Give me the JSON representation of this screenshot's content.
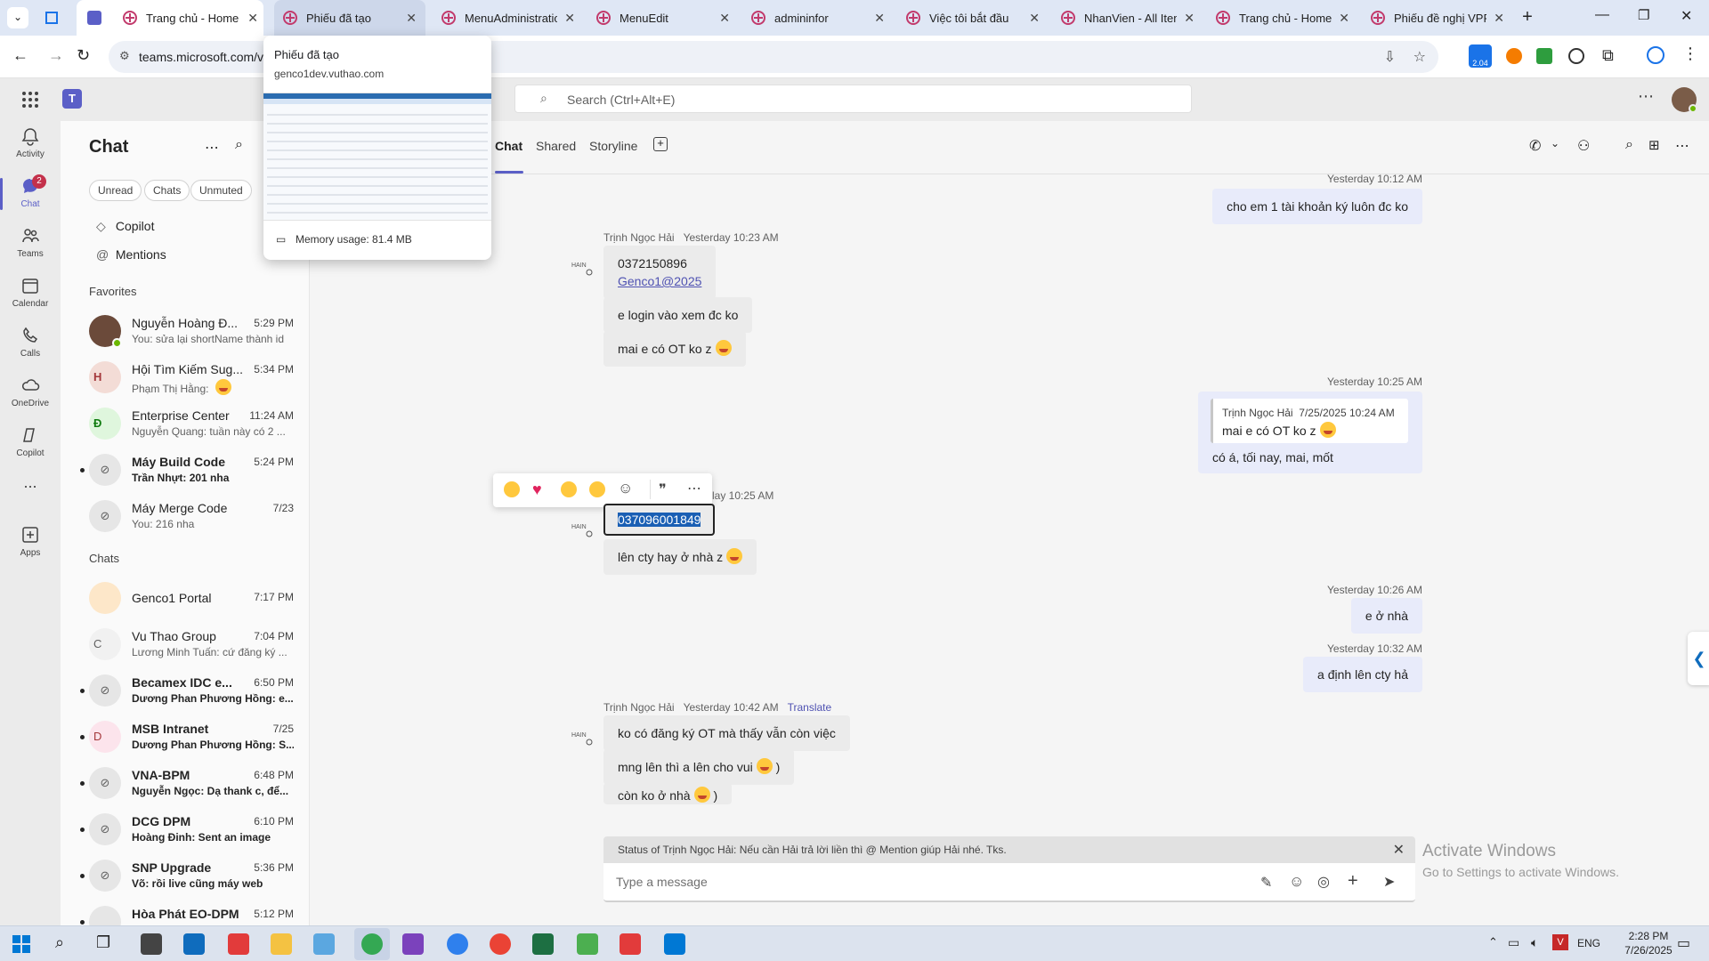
{
  "browser": {
    "tabs": [
      {
        "title": ""
      },
      {
        "title": "Trang chủ - Home"
      },
      {
        "title": "Phiếu đã tạo"
      },
      {
        "title": "MenuAdministratio"
      },
      {
        "title": "MenuEdit"
      },
      {
        "title": "admininfor"
      },
      {
        "title": "Việc tôi bắt đầu"
      },
      {
        "title": "NhanVien - All Item"
      },
      {
        "title": "Trang chủ - Home"
      },
      {
        "title": "Phiếu đề nghị VPP"
      }
    ],
    "url": "teams.microsoft.com/v",
    "ext_badge": "2.04"
  },
  "hover_card": {
    "title": "Phiếu đã tạo",
    "domain": "genco1dev.vuthao.com",
    "memory": "Memory usage: 81.4 MB"
  },
  "teams": {
    "search_placeholder": "Search (Ctrl+Alt+E)",
    "rail": [
      {
        "label": "Activity",
        "icon": "bell-icon"
      },
      {
        "label": "Chat",
        "icon": "chat-icon",
        "badge": "2"
      },
      {
        "label": "Teams",
        "icon": "teams-icon"
      },
      {
        "label": "Calendar",
        "icon": "calendar-icon"
      },
      {
        "label": "Calls",
        "icon": "phone-icon"
      },
      {
        "label": "OneDrive",
        "icon": "cloud-icon"
      },
      {
        "label": "Copilot",
        "icon": "copilot-icon"
      },
      {
        "label": "Apps",
        "icon": "apps-icon"
      }
    ],
    "more_label": "..."
  },
  "chatlist": {
    "title": "Chat",
    "filters": [
      "Unread",
      "Chats",
      "Unmuted"
    ],
    "pinned": [
      "Copilot",
      "Mentions"
    ],
    "favorites_header": "Favorites",
    "favorites": [
      {
        "name": "Nguyễn Hoàng Đ...",
        "time": "5:29 PM",
        "preview": "You:  sửa lại shortName thành id"
      },
      {
        "name": "Hội Tìm Kiếm Sug...",
        "time": "5:34 PM",
        "preview": "Phạm Thị Hằng: "
      },
      {
        "name": "Enterprise Center",
        "time": "11:24 AM",
        "preview": "Nguyễn Quang: tuần này có 2 ..."
      },
      {
        "name": "Máy Build Code",
        "time": "5:24 PM",
        "preview": "Trần Nhựt: 201 nha"
      },
      {
        "name": "Máy Merge Code",
        "time": "7/23",
        "preview": "You: 216  nha"
      }
    ],
    "chats_header": "Chats",
    "chats": [
      {
        "name": "Genco1 Portal",
        "time": "7:17 PM",
        "preview": ""
      },
      {
        "name": "Vu Thao Group",
        "time": "7:04 PM",
        "preview": "Lương Minh Tuấn: cứ đăng ký ..."
      },
      {
        "name": "Becamex IDC e...",
        "time": "6:50 PM",
        "preview": "Dương Phan Phương Hồng: e..."
      },
      {
        "name": "MSB Intranet",
        "time": "7/25",
        "preview": "Dương Phan Phương Hồng: S..."
      },
      {
        "name": "VNA-BPM",
        "time": "6:48 PM",
        "preview": "Nguyễn Ngọc: Dạ thank c, để..."
      },
      {
        "name": "DCG DPM",
        "time": "6:10 PM",
        "preview": "Hoàng Đinh: Sent an image"
      },
      {
        "name": "SNP Upgrade",
        "time": "5:36 PM",
        "preview": "Võ: rồi live cũng máy web"
      },
      {
        "name": "Hòa Phát EO-DPM",
        "time": "5:12 PM",
        "preview": ""
      }
    ]
  },
  "conversation": {
    "tabs": [
      "Chat",
      "Shared",
      "Storyline"
    ],
    "messages": {
      "m1_time": "Yesterday 10:12 AM",
      "m1_text": "cho em 1 tài khoản ký luôn đc ko",
      "s1_name": "Trịnh Ngọc Hải",
      "s1_time": "Yesterday 10:23 AM",
      "s1_phone": "0372150896",
      "s1_link": "Genco1@2025",
      "s1_b2": "e login vào xem đc ko",
      "s1_b3": "mai e có OT ko z",
      "m2_time": "Yesterday 10:25 AM",
      "quote_name": "Trịnh Ngọc Hải",
      "quote_time": "7/25/2025 10:24 AM",
      "quote_text": "mai e có OT ko z",
      "m2_text": "có á, tối nay, mai, mốt",
      "s2_time": "lay 10:25 AM",
      "s2_selected": "037096001849",
      "s2_b2": "lên cty hay ở nhà z",
      "m3_time": "Yesterday 10:26 AM",
      "m3_text": "e ở nhà",
      "m4_time": "Yesterday 10:32 AM",
      "m4_text": "a định lên cty hả",
      "s3_name": "Trịnh Ngọc Hải",
      "s3_time": "Yesterday 10:42 AM",
      "s3_translate": "Translate",
      "s3_b1": "ko có đăng ký OT mà thấy vẫn còn việc",
      "s3_b2": "mng lên thì a lên cho vui",
      "s3_b2_tail": ")",
      "s3_b3": "còn ko ở nhà",
      "s3_b3_tail": ")"
    },
    "status_banner": "Status of Trịnh Ngọc Hải: Nếu cần Hải trả lời liền thì @ Mention giúp Hải nhé. Tks.",
    "compose_placeholder": "Type a message",
    "watermark_title": "Activate Windows",
    "watermark_sub": "Go to Settings to activate Windows."
  },
  "taskbar": {
    "lang": "ENG",
    "time": "2:28 PM",
    "date": "7/26/2025"
  },
  "colors": {
    "accent": "#5b5fc7",
    "unread_badge": "#c4314b",
    "out_bubble": "#e8ebfa"
  }
}
